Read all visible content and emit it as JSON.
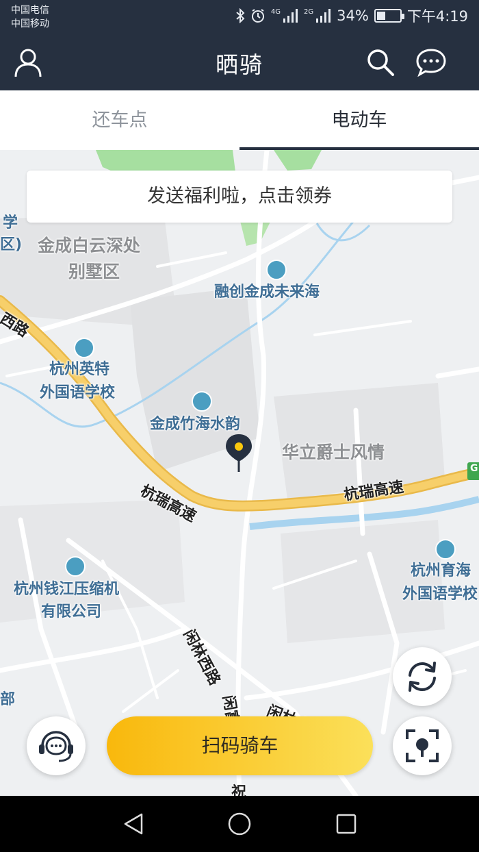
{
  "status_bar": {
    "carrier_1": "中国电信",
    "carrier_2": "中国移动",
    "net_1": "4G",
    "net_2": "2G",
    "battery": "34%",
    "time": "下午4:19"
  },
  "header": {
    "title": "晒骑",
    "icons": [
      "user-icon",
      "search-icon",
      "message-icon"
    ]
  },
  "tabs": [
    {
      "label": "还车点",
      "active": false
    },
    {
      "label": "电动车",
      "active": true
    }
  ],
  "coupon_banner": "发送福利啦，点击领券",
  "map": {
    "labels": {
      "jincheng_baiyun_1": "金成白云深处",
      "jincheng_baiyun_2": "别墅区",
      "rongchuang": "融创金成未来海",
      "yingte_1": "杭州英特",
      "yingte_2": "外国语学校",
      "zhuhai": "金成竹海水韵",
      "huali": "华立爵士风情",
      "yuhai_1": "杭州育海",
      "yuhai_2": "外国语学校",
      "qianjiang_1": "杭州钱江压缩机",
      "qianjiang_2": "有限公司",
      "hangrui_1": "杭瑞高速",
      "hangrui_2": "杭瑞高速",
      "xilu": "西路",
      "xianlin_xi": "闲林西路",
      "xianlin_zhong": "闲林中路",
      "xianfu": "闲富",
      "xianzhu": "祝",
      "left_xue": "学",
      "left_qu": "区)",
      "left_bu": "部",
      "badge_g": "G"
    }
  },
  "scan_button": "扫码骑车",
  "colors": {
    "header_bg": "#263040",
    "accent_yellow": "#f9b80c",
    "poi_blue": "#4b9ec1",
    "highway": "#f5c75a"
  }
}
